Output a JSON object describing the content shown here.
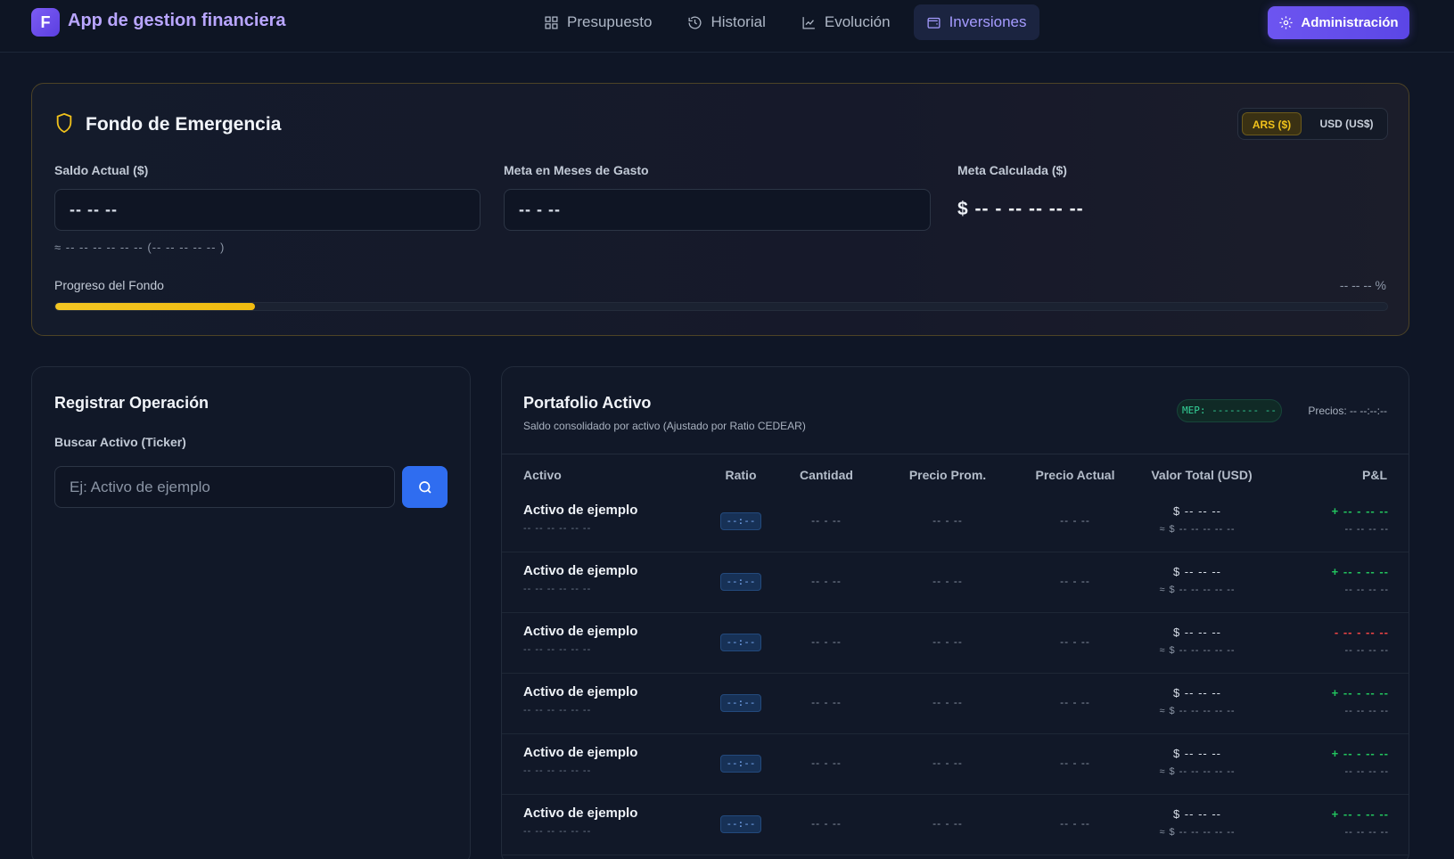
{
  "header": {
    "logo_letter": "F",
    "app_title": "App de gestion financiera",
    "nav": [
      {
        "label": "Presupuesto",
        "icon": "grid-icon",
        "active": false
      },
      {
        "label": "Historial",
        "icon": "history-icon",
        "active": false
      },
      {
        "label": "Evolución",
        "icon": "chart-line-icon",
        "active": false
      },
      {
        "label": "Inversiones",
        "icon": "wallet-icon",
        "active": true
      }
    ],
    "admin_label": "Administración"
  },
  "fund": {
    "title": "Fondo de Emergencia",
    "currency_ars": "ARS ($)",
    "currency_usd": "USD (US$)",
    "saldo_label": "Saldo Actual ($)",
    "saldo_value": "-- -- --",
    "meta_label": "Meta en Meses de Gasto",
    "meta_value": "-- - --",
    "calc_label": "Meta Calculada ($)",
    "calc_value": "$ -- - -- -- -- --",
    "approx": "≈ -- -- -- -- -- -- (-- -- -- -- -- )",
    "progress_label": "Progreso del Fondo",
    "progress_pct": "-- -- -- %",
    "progress_fraction": 0.15,
    "accent": "#f1c21b"
  },
  "register": {
    "title": "Registrar Operación",
    "search_label": "Buscar Activo (Ticker)",
    "search_placeholder": "Ej: Activo de ejemplo"
  },
  "portfolio": {
    "title": "Portafolio Activo",
    "subtitle": "Saldo consolidado por activo (Ajustado por Ratio CEDEAR)",
    "mep": "MEP: -------- --",
    "prices": "Precios: -- --:--:--",
    "columns": [
      "Activo",
      "Ratio",
      "Cantidad",
      "Precio Prom.",
      "Precio Actual",
      "Valor Total (USD)",
      "P&L"
    ],
    "rows": [
      {
        "name": "Activo de ejemplo",
        "sub": "-- -- -- -- -- --",
        "ratio": "--:--",
        "cantidad": "-- - --",
        "prom": "-- - --",
        "actual": "-- - --",
        "valor": "$ -- -- --",
        "valor_sub": "≈ $ -- -- -- -- --",
        "pl": "+ -- - -- --",
        "pl_sub": "-- -- -- --",
        "pl_sign": "pos"
      },
      {
        "name": "Activo de ejemplo",
        "sub": "-- -- -- -- -- --",
        "ratio": "--:--",
        "cantidad": "-- - --",
        "prom": "-- - --",
        "actual": "-- - --",
        "valor": "$ -- -- --",
        "valor_sub": "≈ $ -- -- -- -- --",
        "pl": "+ -- - -- --",
        "pl_sub": "-- -- -- --",
        "pl_sign": "pos"
      },
      {
        "name": "Activo de ejemplo",
        "sub": "-- -- -- -- -- --",
        "ratio": "--:--",
        "cantidad": "-- - --",
        "prom": "-- - --",
        "actual": "-- - --",
        "valor": "$ -- -- --",
        "valor_sub": "≈ $ -- -- -- -- --",
        "pl": "- -- - -- --",
        "pl_sub": "-- -- -- --",
        "pl_sign": "neg"
      },
      {
        "name": "Activo de ejemplo",
        "sub": "-- -- -- -- -- --",
        "ratio": "--:--",
        "cantidad": "-- - --",
        "prom": "-- - --",
        "actual": "-- - --",
        "valor": "$ -- -- --",
        "valor_sub": "≈ $ -- -- -- -- --",
        "pl": "+ -- - -- --",
        "pl_sub": "-- -- -- --",
        "pl_sign": "pos"
      },
      {
        "name": "Activo de ejemplo",
        "sub": "-- -- -- -- -- --",
        "ratio": "--:--",
        "cantidad": "-- - --",
        "prom": "-- - --",
        "actual": "-- - --",
        "valor": "$ -- -- --",
        "valor_sub": "≈ $ -- -- -- -- --",
        "pl": "+ -- - -- --",
        "pl_sub": "-- -- -- --",
        "pl_sign": "pos"
      },
      {
        "name": "Activo de ejemplo",
        "sub": "-- -- -- -- -- --",
        "ratio": "--:--",
        "cantidad": "-- - --",
        "prom": "-- - --",
        "actual": "-- - --",
        "valor": "$ -- -- --",
        "valor_sub": "≈ $ -- -- -- -- --",
        "pl": "+ -- - -- --",
        "pl_sub": "-- -- -- --",
        "pl_sign": "pos"
      }
    ]
  }
}
